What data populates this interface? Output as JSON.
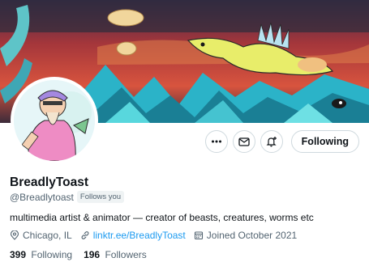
{
  "profile": {
    "display_name": "BreadlyToast",
    "handle": "@Breadlytoast",
    "follows_you": "Follows you",
    "bio": "multimedia artist & animator — creator of beasts, creatures, worms etc",
    "location": "Chicago, IL",
    "website": "linktr.ee/BreadlyToast",
    "joined": "Joined October 2021",
    "following_count": "399",
    "following_label": "Following",
    "followers_count": "196",
    "followers_label": "Followers"
  },
  "actions": {
    "follow_label": "Following",
    "more_icon": "more-icon",
    "message_icon": "mail-icon",
    "notify_icon": "bell-plus-icon"
  },
  "colors": {
    "accent": "#1d9bf0",
    "text": "#0f1419",
    "secondary": "#536471"
  }
}
